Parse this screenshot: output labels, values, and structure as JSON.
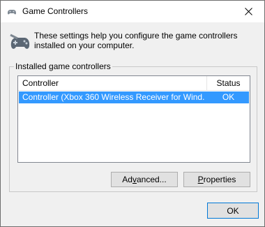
{
  "window": {
    "title": "Game Controllers",
    "close_label": "✕"
  },
  "info": {
    "text": "These settings help you configure the game controllers installed on your computer."
  },
  "group": {
    "legend": "Installed game controllers"
  },
  "list": {
    "columns": [
      "Controller",
      "Status"
    ],
    "rows": [
      {
        "controller": "Controller (Xbox 360 Wireless Receiver for Wind...",
        "status": "OK",
        "selected": true
      }
    ]
  },
  "buttons": {
    "advanced": {
      "prefix": "Ad",
      "accel": "v",
      "suffix": "anced..."
    },
    "properties": {
      "prefix": "",
      "accel": "P",
      "suffix": "roperties"
    },
    "ok": "OK"
  },
  "colors": {
    "selection": "#3399ff",
    "window_bg": "#f0f0f0",
    "accent_border": "#0078d7"
  },
  "icons": {
    "title": "gamepad-icon",
    "info": "gamepad-icon"
  }
}
